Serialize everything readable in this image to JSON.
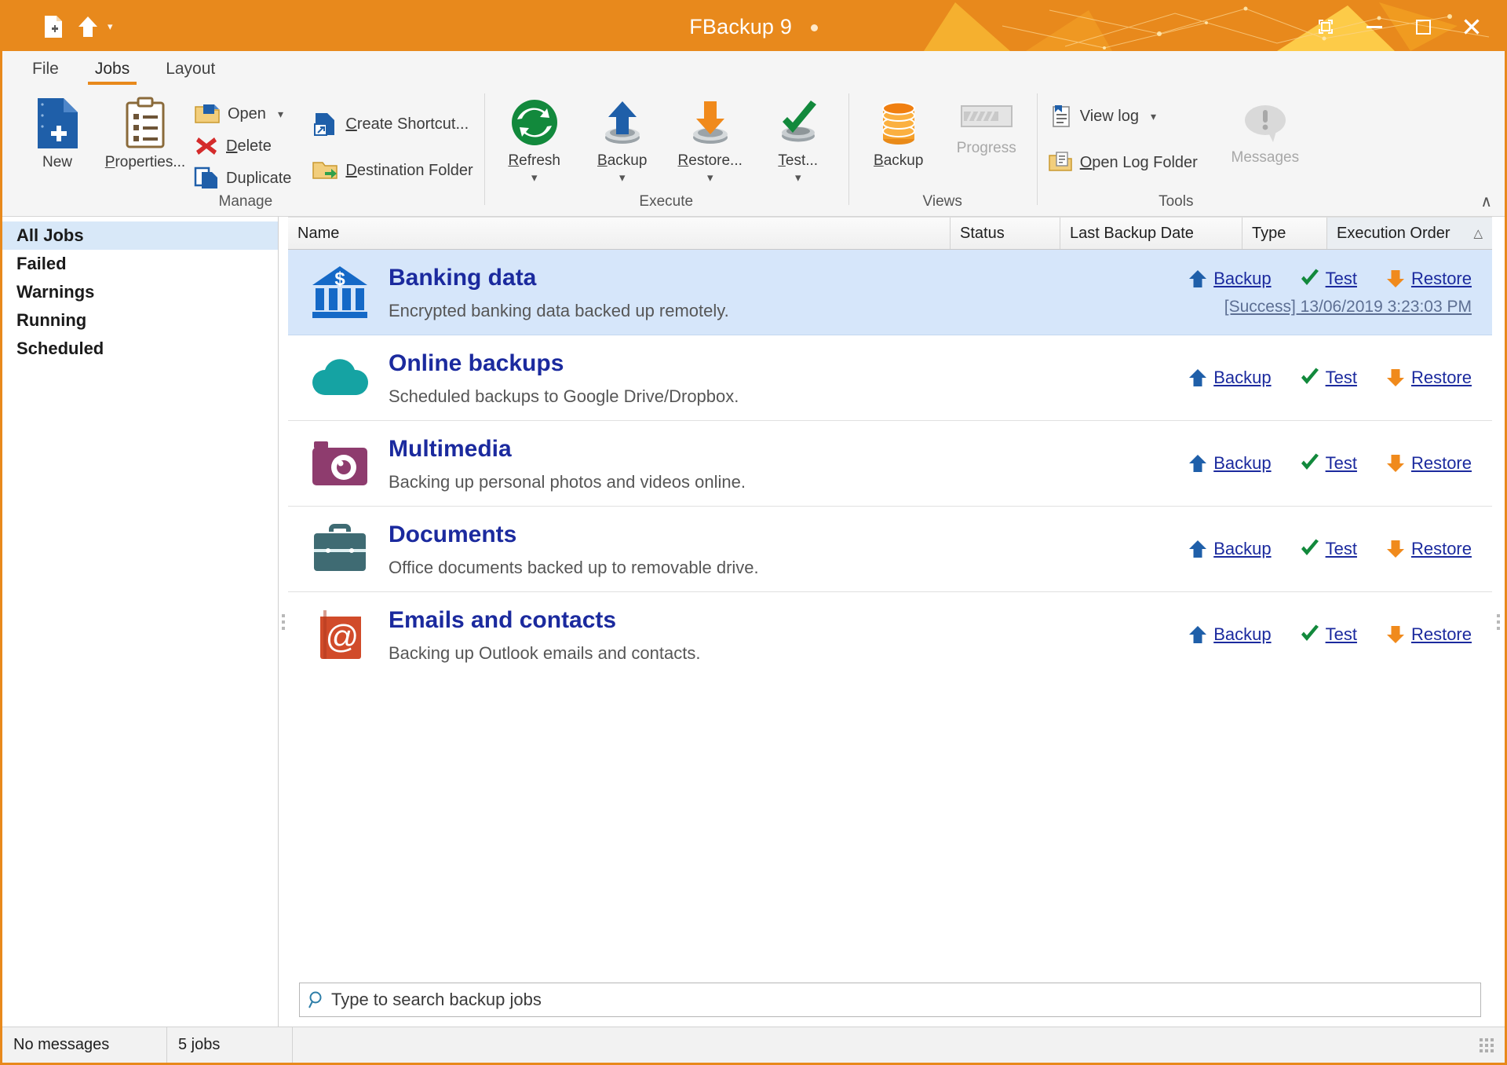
{
  "window": {
    "title": "FBackup 9",
    "quick_access": [
      {
        "name": "new-job-icon",
        "label": "New"
      },
      {
        "name": "backup-icon",
        "label": "Backup"
      },
      {
        "name": "chevron-down-icon",
        "label": "Customize Quick Access Toolbar"
      }
    ],
    "controls": {
      "minimize": "–",
      "restore": "❐",
      "maximize": "□",
      "close": "✕"
    }
  },
  "tabs": [
    {
      "label": "File",
      "active": false
    },
    {
      "label": "Jobs",
      "active": true
    },
    {
      "label": "Layout",
      "active": false
    }
  ],
  "ribbon": {
    "collapse_glyph": "∧",
    "groups": [
      {
        "label": "Manage",
        "big_buttons": [
          {
            "label": "New",
            "icon": "new-document-icon",
            "disabled": false,
            "dropdown": false
          },
          {
            "label": "Properties...",
            "icon": "clipboard-icon",
            "disabled": false,
            "dropdown": false
          }
        ],
        "small_columns": [
          [
            {
              "label": "Open",
              "icon": "open-folder-icon",
              "dropdown": true
            },
            {
              "label": "Delete",
              "icon": "delete-x-icon",
              "dropdown": false
            },
            {
              "label": "Duplicate",
              "icon": "duplicate-icon",
              "dropdown": false
            }
          ],
          [
            {
              "label": "Create Shortcut...",
              "icon": "shortcut-icon",
              "dropdown": false
            },
            {
              "label": "Destination Folder",
              "icon": "destination-folder-icon",
              "dropdown": false
            }
          ]
        ]
      },
      {
        "label": "Execute",
        "big_buttons": [
          {
            "label": "Refresh",
            "icon": "refresh-icon",
            "disabled": false,
            "dropdown": true
          },
          {
            "label": "Backup",
            "icon": "backup-up-arrow-icon",
            "disabled": false,
            "dropdown": true
          },
          {
            "label": "Restore...",
            "icon": "restore-down-arrow-icon",
            "disabled": false,
            "dropdown": true
          },
          {
            "label": "Test...",
            "icon": "test-check-icon",
            "disabled": false,
            "dropdown": true
          }
        ],
        "small_columns": []
      },
      {
        "label": "Views",
        "big_buttons": [
          {
            "label": "Backup",
            "icon": "database-stack-icon",
            "disabled": false,
            "dropdown": false
          },
          {
            "label": "Progress",
            "icon": "progress-bar-icon",
            "disabled": true,
            "dropdown": false
          }
        ],
        "small_columns": []
      },
      {
        "label": "Tools",
        "big_buttons": [
          {
            "label": "Messages",
            "icon": "messages-bubble-icon",
            "disabled": true,
            "dropdown": false
          }
        ],
        "small_columns": [
          [
            {
              "label": "View log",
              "icon": "view-log-icon",
              "dropdown": true
            },
            {
              "label": "Open Log Folder",
              "icon": "open-log-folder-icon",
              "dropdown": false
            }
          ]
        ]
      }
    ]
  },
  "sidebar": {
    "items": [
      {
        "label": "All Jobs",
        "selected": true
      },
      {
        "label": "Failed",
        "selected": false
      },
      {
        "label": "Warnings",
        "selected": false
      },
      {
        "label": "Running",
        "selected": false
      },
      {
        "label": "Scheduled",
        "selected": false
      }
    ]
  },
  "list": {
    "columns": [
      {
        "key": "name",
        "label": "Name"
      },
      {
        "key": "status",
        "label": "Status"
      },
      {
        "key": "date",
        "label": "Last Backup Date"
      },
      {
        "key": "type",
        "label": "Type"
      },
      {
        "key": "order",
        "label": "Execution Order",
        "sorted": "asc",
        "sort_glyph": "△"
      }
    ],
    "actions": {
      "backup": "Backup",
      "test": "Test",
      "restore": "Restore"
    },
    "rows": [
      {
        "name": "Banking data",
        "description": "Encrypted banking data backed up remotely.",
        "icon": "bank-icon",
        "icon_color": "#1569C7",
        "selected": true,
        "status_text": "[Success] 13/06/2019 3:23:03 PM"
      },
      {
        "name": "Online backups",
        "description": "Scheduled backups to Google Drive/Dropbox.",
        "icon": "cloud-icon",
        "icon_color": "#15A3A3",
        "selected": false,
        "status_text": ""
      },
      {
        "name": "Multimedia",
        "description": "Backing up personal photos and videos online.",
        "icon": "camera-icon",
        "icon_color": "#8E3C6E",
        "selected": false,
        "status_text": ""
      },
      {
        "name": "Documents",
        "description": "Office documents backed up to removable drive.",
        "icon": "briefcase-icon",
        "icon_color": "#3F6B73",
        "selected": false,
        "status_text": ""
      },
      {
        "name": "Emails and contacts",
        "description": "Backing up Outlook emails and contacts.",
        "icon": "email-book-icon",
        "icon_color": "#D14B2A",
        "selected": false,
        "status_text": ""
      }
    ]
  },
  "search": {
    "placeholder": "Type to search backup jobs",
    "value": "",
    "icon": "search-icon"
  },
  "statusbar": {
    "messages": "No messages",
    "job_count": "5 jobs"
  },
  "colors": {
    "accent_orange": "#E8891C",
    "selection_blue": "#D6E6FA",
    "link_blue": "#1B2A9E"
  }
}
